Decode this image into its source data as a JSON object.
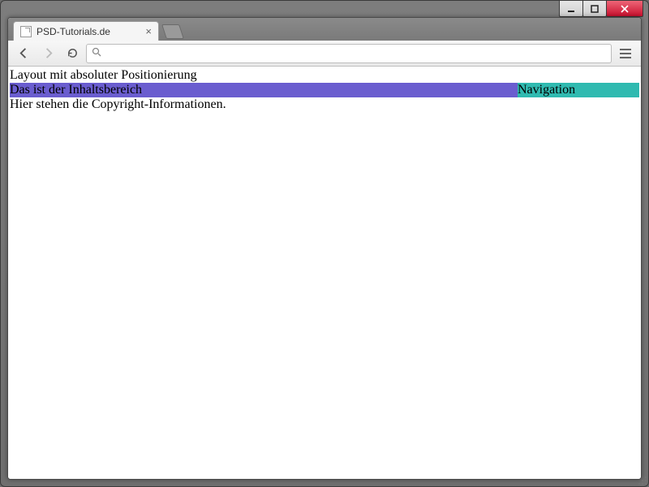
{
  "window": {
    "tab_title": "PSD-Tutorials.de"
  },
  "toolbar": {
    "omnibox_value": ""
  },
  "page": {
    "header": "Layout mit absoluter Positionierung",
    "content": "Das ist der Inhaltsbereich",
    "nav": "Navigation",
    "footer": "Hier stehen die Copyright-Informationen."
  },
  "colors": {
    "content_bg": "#6a5dcf",
    "nav_bg": "#2fbab0"
  }
}
